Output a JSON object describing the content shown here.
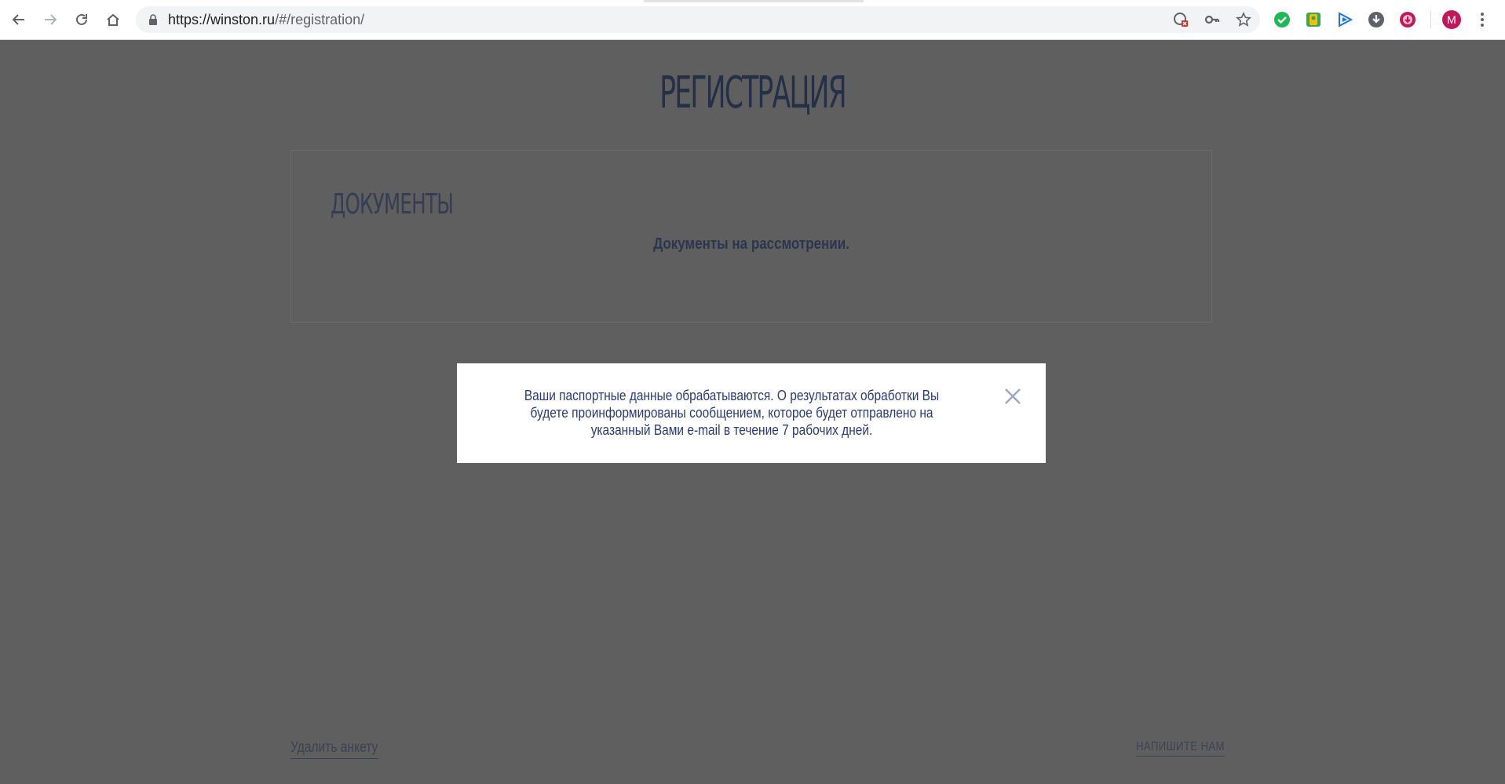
{
  "browser": {
    "url_host": "https://winston.ru",
    "url_path": "/#/registration/",
    "avatar_letter": "M",
    "icons": [
      "back-icon",
      "forward-icon",
      "reload-icon",
      "home-icon",
      "lock-icon",
      "translate-blocked-icon",
      "key-icon",
      "star-icon",
      "check-extension-icon",
      "extension-icon",
      "play-extension-icon",
      "download-extension-icon",
      "video-download-icon",
      "menu-icon"
    ]
  },
  "page": {
    "title": "РЕГИСТРАЦИЯ",
    "documents": {
      "heading": "ДОКУМЕНТЫ",
      "status": "Документы на рассмотрении."
    },
    "footer": {
      "delete_link": "Удалить анкету",
      "contact_link": "НАПИШИТЕ НАМ"
    }
  },
  "modal": {
    "message": "Ваши паспортные данные обрабатываются. О результатах обработки Вы будете проинформированы сообщением, которое будет отправлено на указанный Вами e-mail в течение 7 рабочих дней."
  },
  "colors": {
    "overlay": "#5f5f5f",
    "title": "#253046",
    "modal_text": "#2a3a7a",
    "close": "#9aa6c4"
  }
}
